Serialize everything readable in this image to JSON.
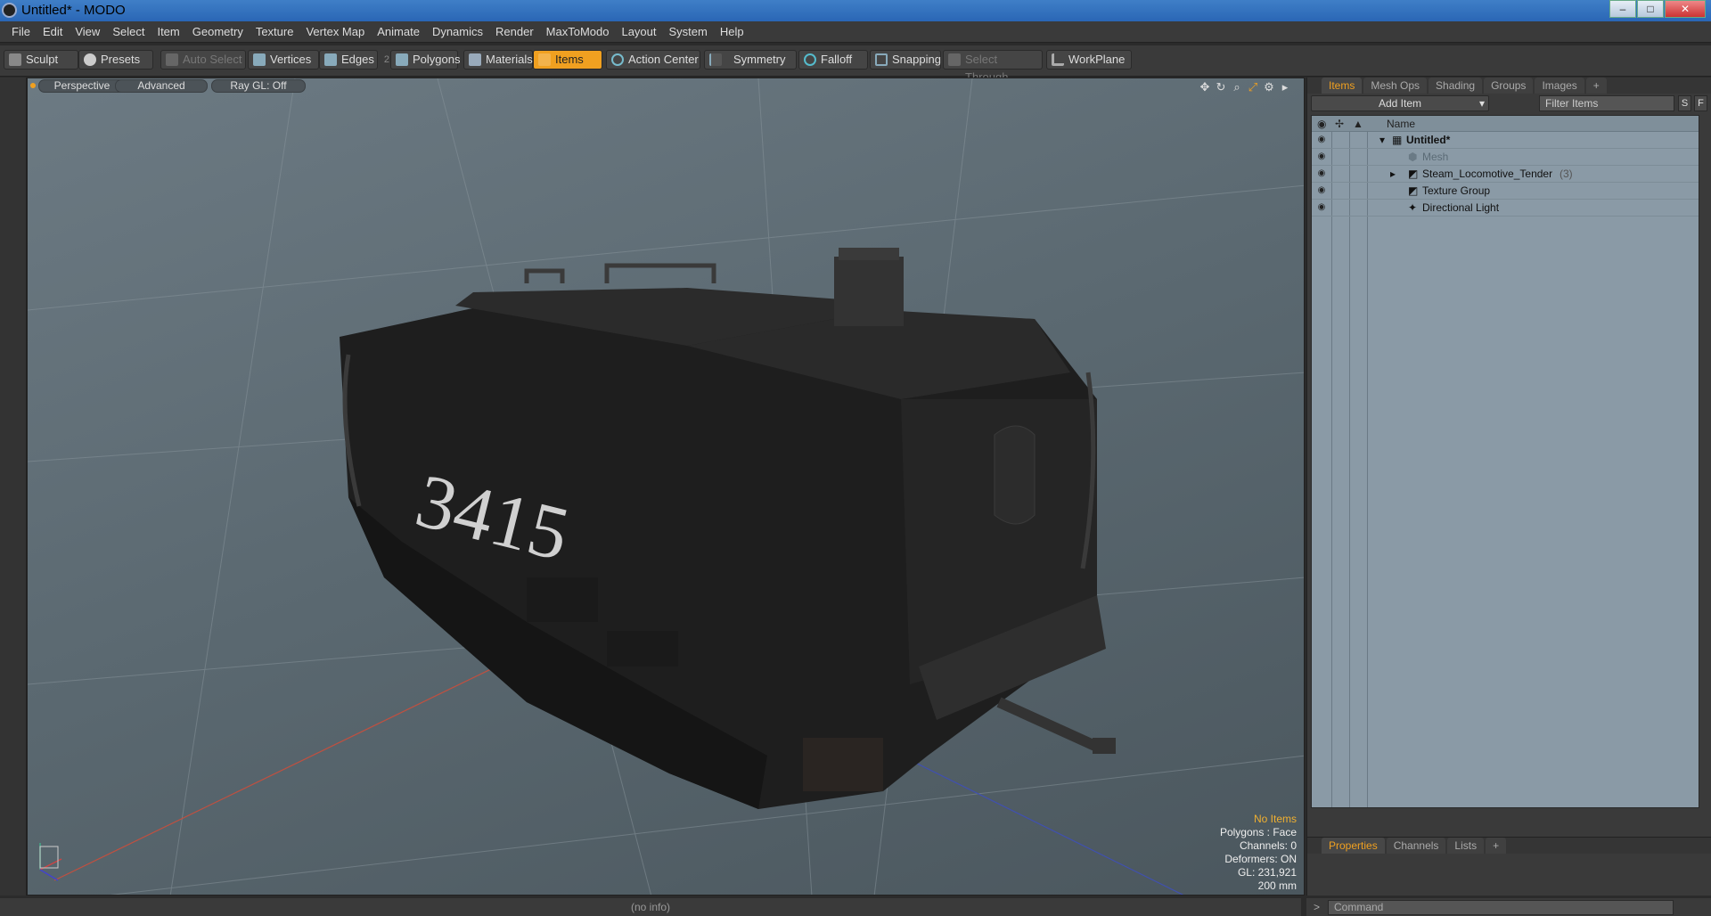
{
  "window": {
    "title": "Untitled* - MODO",
    "minimize": "–",
    "maximize": "□",
    "close": "✕"
  },
  "menu": [
    "File",
    "Edit",
    "View",
    "Select",
    "Item",
    "Geometry",
    "Texture",
    "Vertex Map",
    "Animate",
    "Dynamics",
    "Render",
    "MaxToModo",
    "Layout",
    "System",
    "Help"
  ],
  "toolbar": {
    "sculpt": "Sculpt",
    "presets": "Presets",
    "auto_select": "Auto Select",
    "vertices": "Vertices",
    "edges": "Edges",
    "edges_count": "2",
    "polygons": "Polygons",
    "materials": "Materials",
    "items": "Items",
    "action_center": "Action Center",
    "symmetry": "Symmetry",
    "falloff": "Falloff",
    "snapping": "Snapping",
    "select_through": "Select Through",
    "workplane": "WorkPlane"
  },
  "viewport": {
    "tab_perspective": "Perspective",
    "tab_advanced": "Advanced",
    "tab_raygl": "Ray GL: Off",
    "model_number": "3415",
    "stats": {
      "items": "No Items",
      "polygons": "Polygons : Face",
      "channels": "Channels: 0",
      "deformers": "Deformers: ON",
      "gl": "GL: 231,921",
      "scale": "200 mm"
    }
  },
  "panel": {
    "tabs": [
      "Items",
      "Mesh Ops",
      "Shading",
      "Groups",
      "Images",
      "+"
    ],
    "add_item": "Add Item",
    "filter_placeholder": "Filter Items",
    "s_btn": "S",
    "f_btn": "F",
    "name_header": "Name",
    "tree": [
      {
        "label": "Untitled*",
        "indent": 0
      },
      {
        "label": "Mesh",
        "indent": 1
      },
      {
        "label": "Steam_Locomotive_Tender",
        "count": "(3)",
        "indent": 1
      },
      {
        "label": "Texture Group",
        "indent": 1
      },
      {
        "label": "Directional Light",
        "indent": 1
      }
    ],
    "bottom_tabs": [
      "Properties",
      "Channels",
      "Lists",
      "+"
    ]
  },
  "statusbar": {
    "info": "(no info)",
    "command_placeholder": "Command"
  },
  "colors": {
    "accent": "#f0a020",
    "viewport": "#5a6870"
  }
}
